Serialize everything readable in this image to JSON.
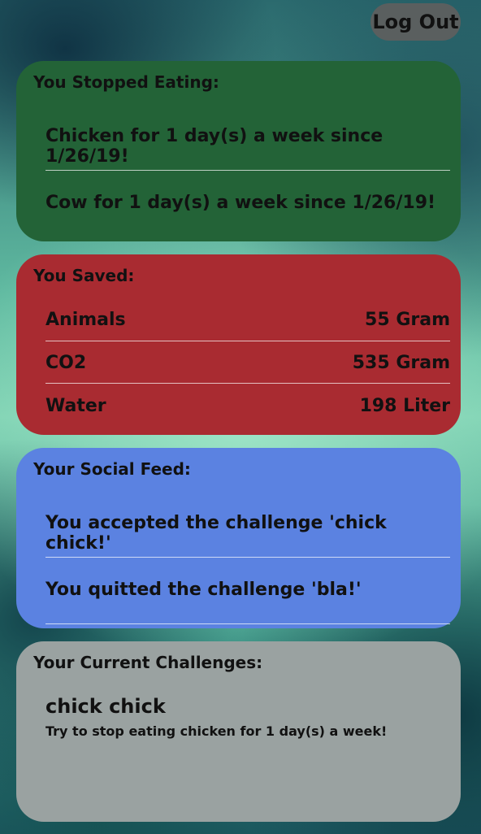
{
  "header": {
    "logout_label": "Log Out"
  },
  "stopped_eating": {
    "title": "You Stopped Eating:",
    "items": [
      "Chicken for 1 day(s) a week since 1/26/19!",
      "Cow for 1 day(s) a week since 1/26/19!"
    ]
  },
  "saved": {
    "title": "You Saved:",
    "rows": [
      {
        "label": "Animals",
        "value": "55 Gram"
      },
      {
        "label": "CO2",
        "value": "535 Gram"
      },
      {
        "label": "Water",
        "value": "198 Liter"
      }
    ]
  },
  "social_feed": {
    "title": "Your Social Feed:",
    "items": [
      "You accepted the challenge 'chick chick!'",
      "You quitted the challenge 'bla!'"
    ]
  },
  "current_challenges": {
    "title": "Your Current Challenges:",
    "items": [
      {
        "name": "chick chick",
        "description": "Try to stop eating chicken for 1 day(s) a week!"
      }
    ]
  },
  "colors": {
    "stopped_card": "#236337",
    "saved_card": "#a92b31",
    "feed_card": "#5b82e1",
    "challenges_card": "#9aa2a1",
    "logout_button": "#5a5f5f"
  }
}
